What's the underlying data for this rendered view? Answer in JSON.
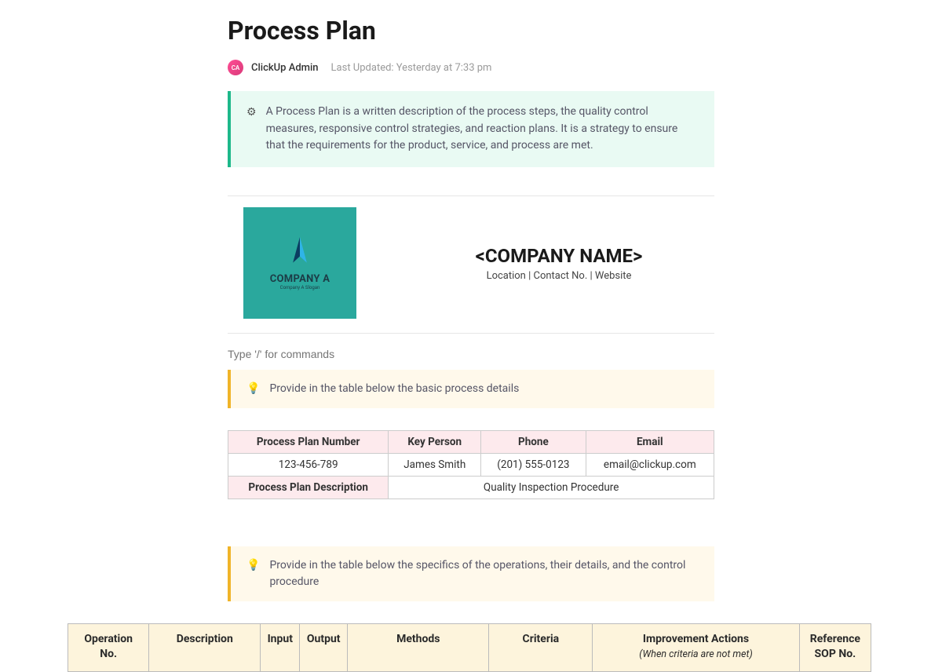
{
  "page": {
    "title": "Process Plan",
    "avatar_initials": "CA",
    "author": "ClickUp Admin",
    "last_updated": "Last Updated: Yesterday at 7:33 pm"
  },
  "intro": {
    "icon": "⚙",
    "text": "A Process Plan is a written description of the process steps, the quality control measures, responsive control strategies, and reaction plans. It is a strategy to ensure that the requirements for the product, service, and process are met."
  },
  "company": {
    "logo_name": "COMPANY A",
    "logo_slogan": "Company A Slogan",
    "name_placeholder": "<COMPANY NAME>",
    "sub": "Location | Contact No. | Website"
  },
  "command_placeholder": "Type '/' for commands",
  "hint1": {
    "icon": "💡",
    "text": "Provide in the table below the basic process details"
  },
  "details": {
    "headers": [
      "Process Plan Number",
      "Key Person",
      "Phone",
      "Email"
    ],
    "row": [
      "123-456-789",
      "James Smith",
      "(201) 555-0123",
      "email@clickup.com"
    ],
    "desc_label": "Process Plan Description",
    "desc_value": "Quality Inspection Procedure"
  },
  "hint2": {
    "icon": "💡",
    "text": "Provide in the table below the specifics of the operations, their details, and the control procedure"
  },
  "ops": {
    "headers": [
      "Operation No.",
      "Description",
      "Input",
      "Output",
      "Methods",
      "Criteria",
      "Improvement Actions",
      "Reference SOP No."
    ],
    "improvement_sub": "(When criteria are not met)"
  }
}
